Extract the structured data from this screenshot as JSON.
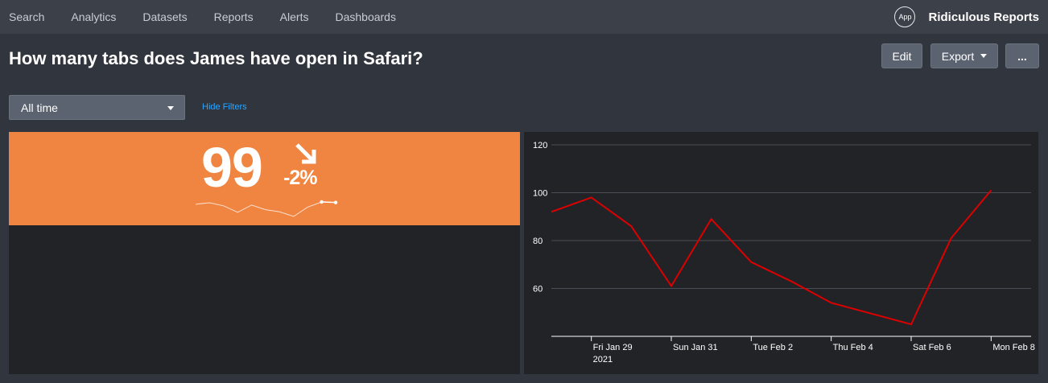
{
  "nav": {
    "items": [
      "Search",
      "Analytics",
      "Datasets",
      "Reports",
      "Alerts",
      "Dashboards"
    ]
  },
  "app": {
    "icon_label": "App",
    "name": "Ridiculous Reports"
  },
  "page": {
    "title": "How many tabs does James have open in Safari?"
  },
  "toolbar": {
    "edit_label": "Edit",
    "export_label": "Export",
    "more_label": "..."
  },
  "filters": {
    "time_range": "All time",
    "hide_filters_label": "Hide Filters"
  },
  "kpi": {
    "value": "99",
    "delta": "-2%",
    "trend": "down",
    "background_color": "#f08541",
    "arrow_icon": "arrow-down-right-icon",
    "sparkline_values": [
      92,
      98,
      86,
      61,
      89,
      71,
      63,
      45,
      81,
      101,
      99
    ]
  },
  "chart_data": {
    "type": "line",
    "x": [
      "2021-01-28",
      "2021-01-29",
      "2021-01-30",
      "2021-01-31",
      "2021-02-01",
      "2021-02-02",
      "2021-02-03",
      "2021-02-04",
      "2021-02-06",
      "2021-02-07",
      "2021-02-08"
    ],
    "series": [
      {
        "values": [
          92,
          98,
          86,
          61,
          89,
          71,
          63,
          54,
          45,
          81,
          101
        ],
        "color": "#dd0000"
      }
    ],
    "x_tick_labels": [
      "Fri Jan 29",
      "Sun Jan 31",
      "Tue Feb 2",
      "Thu Feb 4",
      "Sat Feb 6",
      "Mon Feb 8"
    ],
    "x_year_label": "2021",
    "y_ticks": [
      60,
      80,
      100,
      120
    ],
    "ylim": [
      40,
      120
    ],
    "grid": true,
    "title": "",
    "xlabel": "",
    "ylabel": ""
  }
}
